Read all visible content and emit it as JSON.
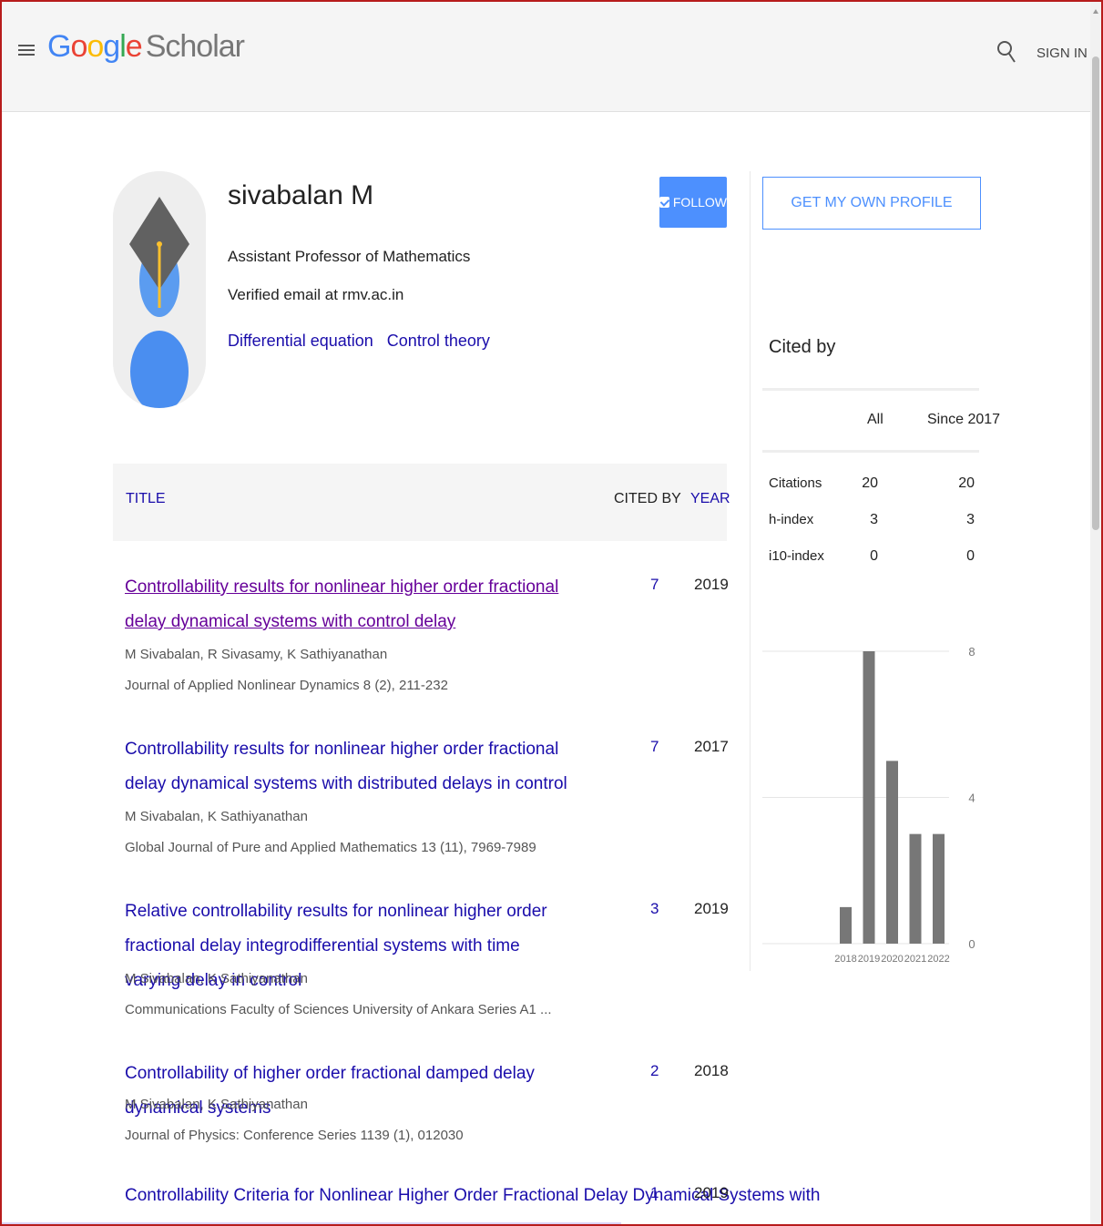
{
  "header": {
    "logo_google": "Google",
    "logo_scholar": "Scholar",
    "sign_in": "SIGN IN"
  },
  "profile": {
    "name": "sivabalan M",
    "affiliation": "Assistant Professor of Mathematics",
    "email": "Verified email at rmv.ac.in",
    "interests": [
      "Differential equation",
      "Control theory"
    ],
    "follow_label": "FOLLOW"
  },
  "table": {
    "col_title": "TITLE",
    "col_cited_by": "CITED BY",
    "col_year": "YEAR"
  },
  "publications": [
    {
      "title": "Controllability results for nonlinear higher order fractional delay dynamical systems with control delay",
      "authors": "M Sivabalan, R Sivasamy, K Sathiyanathan",
      "venue": "Journal of Applied Nonlinear Dynamics 8 (2), 211-232",
      "cited_by": "7",
      "year": "2019"
    },
    {
      "title": "Controllability results for nonlinear higher order fractional delay dynamical systems with distributed delays in control",
      "authors": "M Sivabalan, K Sathiyanathan",
      "venue": "Global Journal of Pure and Applied Mathematics 13 (11), 7969-7989",
      "cited_by": "7",
      "year": "2017"
    },
    {
      "title": "Relative controllability results for nonlinear higher order fractional delay integrodifferential systems with time varying delay in control",
      "authors": "M Sivabalan, K Sathiyanathan",
      "venue": "Communications Faculty of Sciences University of Ankara Series A1 ...",
      "cited_by": "3",
      "year": "2019"
    },
    {
      "title": "Controllability of higher order fractional damped delay dynamical systems",
      "authors": "M Sivabalan, K Sathiyanathan",
      "venue": "Journal of Physics: Conference Series 1139 (1), 012030",
      "cited_by": "2",
      "year": "2018"
    },
    {
      "title": "Controllability Criteria for Nonlinear Higher Order Fractional Delay Dynamical Systems with",
      "cited_by": "1",
      "year": "2019"
    }
  ],
  "sidebar": {
    "own_profile_label": "GET MY OWN PROFILE",
    "cited_by_title": "Cited by",
    "col_all": "All",
    "col_since": "Since 2017",
    "rows": [
      {
        "label": "Citations",
        "all": "20",
        "since": "20"
      },
      {
        "label": "h-index",
        "all": "3",
        "since": "3"
      },
      {
        "label": "i10-index",
        "all": "0",
        "since": "0"
      }
    ]
  },
  "colors": {
    "link": "#1a0dab",
    "visited": "#660099",
    "button_blue": "#4d90fe",
    "bar": "#777777"
  },
  "chart_data": {
    "type": "bar",
    "categories": [
      "2018",
      "2019",
      "2020",
      "2021",
      "2022"
    ],
    "values": [
      1,
      8,
      5,
      3,
      3
    ],
    "ylim": [
      0,
      8
    ],
    "yticks": [
      "8",
      "4",
      "0"
    ],
    "grid": true
  }
}
